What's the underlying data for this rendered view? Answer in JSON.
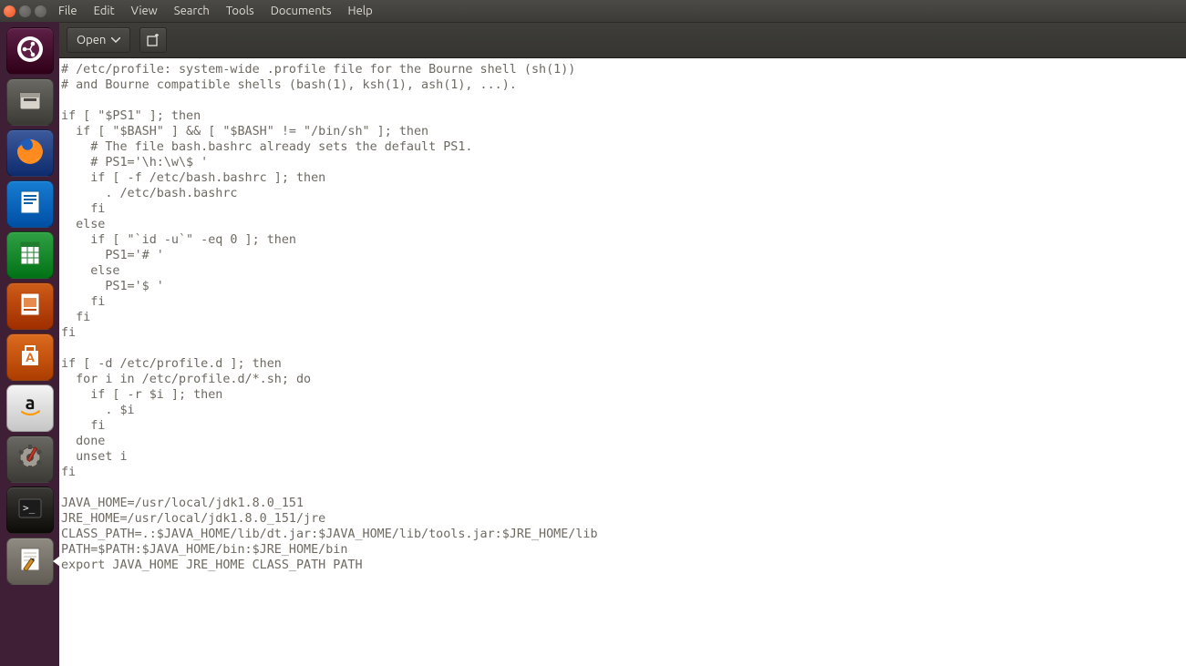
{
  "menubar": {
    "items": [
      "File",
      "Edit",
      "View",
      "Search",
      "Tools",
      "Documents",
      "Help"
    ]
  },
  "toolbar": {
    "open_label": "Open"
  },
  "launcher": {
    "items": [
      {
        "name": "dash",
        "bg": "#5d1f46",
        "icon": "dash"
      },
      {
        "name": "files",
        "bg": "#6a6862",
        "icon": "files"
      },
      {
        "name": "firefox",
        "bg": "#3c599c",
        "icon": "firefox"
      },
      {
        "name": "writer",
        "bg": "#167dd2",
        "icon": "writer"
      },
      {
        "name": "calc",
        "bg": "#2fa043",
        "icon": "calc"
      },
      {
        "name": "impress",
        "bg": "#ce5c18",
        "icon": "impress"
      },
      {
        "name": "software",
        "bg": "#db6b1e",
        "icon": "software"
      },
      {
        "name": "amazon",
        "bg": "#f4f4f4",
        "icon": "amazon"
      },
      {
        "name": "settings",
        "bg": "#6a6862",
        "icon": "settings"
      },
      {
        "name": "terminal",
        "bg": "#3a3935",
        "icon": "terminal"
      },
      {
        "name": "gedit",
        "bg": "#8f8a82",
        "icon": "gedit",
        "active": true
      }
    ]
  },
  "editor": {
    "content": "# /etc/profile: system-wide .profile file for the Bourne shell (sh(1))\n# and Bourne compatible shells (bash(1), ksh(1), ash(1), ...).\n\nif [ \"$PS1\" ]; then\n  if [ \"$BASH\" ] && [ \"$BASH\" != \"/bin/sh\" ]; then\n    # The file bash.bashrc already sets the default PS1.\n    # PS1='\\h:\\w\\$ '\n    if [ -f /etc/bash.bashrc ]; then\n      . /etc/bash.bashrc\n    fi\n  else\n    if [ \"`id -u`\" -eq 0 ]; then\n      PS1='# '\n    else\n      PS1='$ '\n    fi\n  fi\nfi\n\nif [ -d /etc/profile.d ]; then\n  for i in /etc/profile.d/*.sh; do\n    if [ -r $i ]; then\n      . $i\n    fi\n  done\n  unset i\nfi\n\nJAVA_HOME=/usr/local/jdk1.8.0_151\nJRE_HOME=/usr/local/jdk1.8.0_151/jre\nCLASS_PATH=.:$JAVA_HOME/lib/dt.jar:$JAVA_HOME/lib/tools.jar:$JRE_HOME/lib\nPATH=$PATH:$JAVA_HOME/bin:$JRE_HOME/bin\nexport JAVA_HOME JRE_HOME CLASS_PATH PATH"
  },
  "window_buttons": {
    "close": "#e95420",
    "minimize": "#5a5955",
    "maximize": "#5a5955"
  }
}
